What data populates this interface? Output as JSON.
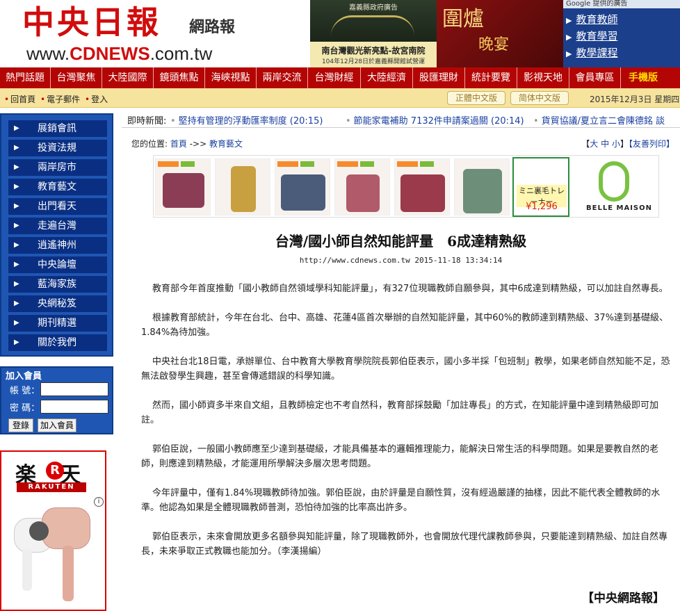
{
  "header": {
    "logo_main": "中央日報",
    "logo_sub": "網路報",
    "logo_url_prefix": "www.",
    "logo_url_brand": "CDNEWS",
    "logo_url_suffix": ".com.tw",
    "banner1_caption": "嘉義縣政府廣告",
    "banner1_line1": "南台灣觀光新亮點-故宮南院",
    "banner1_line2": "104年12月28日於嘉義縣開館試營運",
    "banner2_text": "圍爐",
    "banner2_sub": "晚宴",
    "google_ads_label": "Google 提供的廣告",
    "google_ads": [
      "教育教師",
      "教育學習",
      "教學課程"
    ]
  },
  "nav": {
    "items": [
      "熱門話題",
      "台灣聚焦",
      "大陸國際",
      "鏡頭焦點",
      "海峽視點",
      "兩岸交流",
      "台灣財經",
      "大陸經濟",
      "股匯理財",
      "統計要覽",
      "影視天地",
      "會員專區"
    ],
    "mobile_label": "手機版"
  },
  "subbar": {
    "links": [
      "回首頁",
      "電子郵件",
      "登入"
    ],
    "lang_traditional": "正體中文版",
    "lang_simplified": "简体中文版",
    "date": "2015年12月3日 星期四"
  },
  "sidebar": {
    "menu": [
      "展銷會訊",
      "投資法規",
      "兩岸房市",
      "教育藝文",
      "出門看天",
      "走遍台灣",
      "逍遙神州",
      "中央論壇",
      "藍海家族",
      "央網秘笈",
      "期刊精選",
      "關於我們"
    ],
    "login_title": "加入會員",
    "account_label": "帳 號：",
    "password_label": "密 碼：",
    "login_button": "登錄",
    "join_button": "加入會員"
  },
  "rakuten": {
    "logo_left": "楽",
    "logo_r": "R",
    "logo_right": "天",
    "wordmark": "RAKUTEN",
    "info": "i"
  },
  "ticker": {
    "label": "即時新聞:",
    "items": [
      "堅持有管理的浮動匯率制度 (20:15)",
      "節能家電補助 7132件申請案過關 (20:14)",
      "貨貿協議/夏立言二會陳德銘 談"
    ]
  },
  "breadcrumb": {
    "label": "您的位置:",
    "home": "首頁",
    "sep": "->>",
    "section": "教育藝文"
  },
  "tools": {
    "open": "【",
    "big": "大",
    "mid": "中",
    "small": "小",
    "close": "】",
    "print": "【友善列印】"
  },
  "ad": {
    "price_text": "ミニ裏毛トレーナー",
    "price": "¥1,296",
    "brand": "BELLE MAISON"
  },
  "article": {
    "title": "台灣/國小師自然知能評量　6成達精熟級",
    "meta": "http://www.cdnews.com.tw 2015-11-18 13:34:14",
    "paragraphs": [
      "教育部今年首度推動「國小教師自然領域學科知能評量」，有327位現職教師自願參與，其中6成達到精熟級，可以加註自然專長。",
      "根據教育部統計，今年在台北、台中、高雄、花蓮4區首次舉辦的自然知能評量，其中60%的教師達到精熟級、37%達到基礎級、1.84%為待加強。",
      "中央社台北18日電，承辦單位、台中教育大學教育學院院長郭伯臣表示，國小多半採「包班制」教學，如果老師自然知能不足，恐無法啟發學生興趣，甚至會傳遞錯誤的科學知識。",
      "然而，國小師資多半來自文組，且教師檢定也不考自然科，教育部採鼓勵「加註專長」的方式，在知能評量中達到精熟級即可加註。",
      "郭伯臣說，一般國小教師應至少達到基礎級，才能具備基本的邏輯推理能力，能解決日常生活的科學問題。如果是要教自然的老師，則應達到精熟級，才能運用所學解決多層次思考問題。",
      "今年評量中，僅有1.84%現職教師待加強。郭伯臣說，由於評量是自願性質，沒有經過嚴謹的抽樣，因此不能代表全體教師的水準。他認為如果是全體現職教師普測，恐怕待加強的比率高出許多。",
      "郭伯臣表示，未來會開放更多名額參與知能評量，除了現職教師外，也會開放代理代課教師參與，只要能達到精熟級、加註自然專長，未來爭取正式教職也能加分。（李漢揚編）"
    ],
    "signature": "【中央網路報】"
  }
}
